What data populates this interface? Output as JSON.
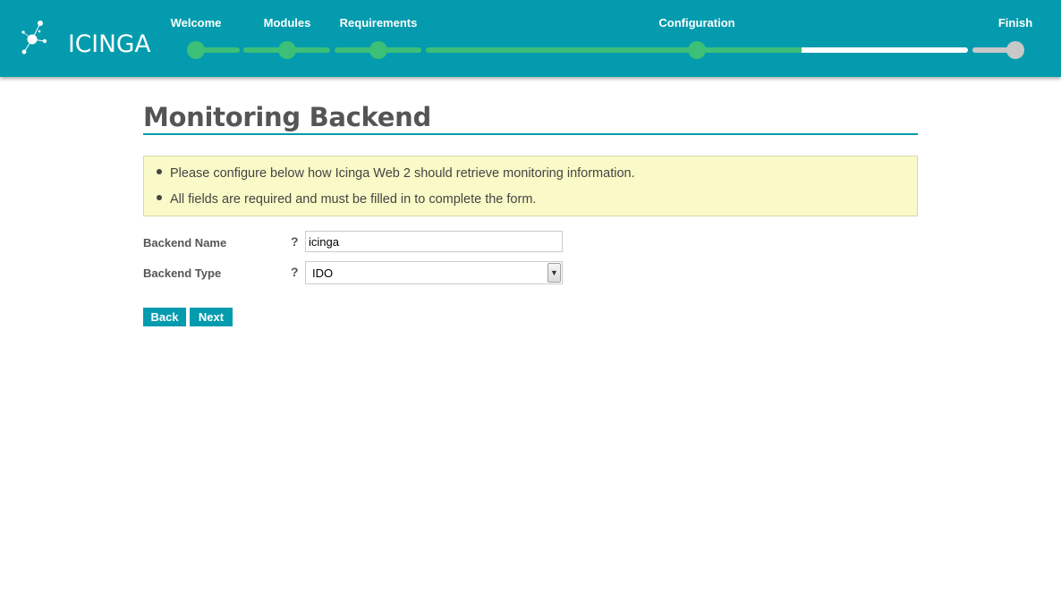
{
  "header": {
    "logo_text": "ICINGA",
    "steps": [
      {
        "label": "Welcome",
        "state": "done"
      },
      {
        "label": "Modules",
        "state": "done"
      },
      {
        "label": "Requirements",
        "state": "done"
      },
      {
        "label": "Configuration",
        "state": "current"
      },
      {
        "label": "Finish",
        "state": "pending"
      }
    ]
  },
  "page": {
    "title": "Monitoring Backend",
    "info": [
      "Please configure below how Icinga Web 2 should retrieve monitoring information.",
      "All fields are required and must be filled in to complete the form."
    ],
    "form": {
      "backend_name_label": "Backend Name",
      "backend_name_value": "icinga",
      "backend_type_label": "Backend Type",
      "backend_type_value": "IDO",
      "help_glyph": "?"
    },
    "buttons": {
      "back": "Back",
      "next": "Next"
    }
  },
  "colors": {
    "teal": "#049bae",
    "green": "#3cbf77",
    "white_track": "#ffffff",
    "grey_track": "#c8c8c8",
    "info_bg": "#fafac8"
  }
}
